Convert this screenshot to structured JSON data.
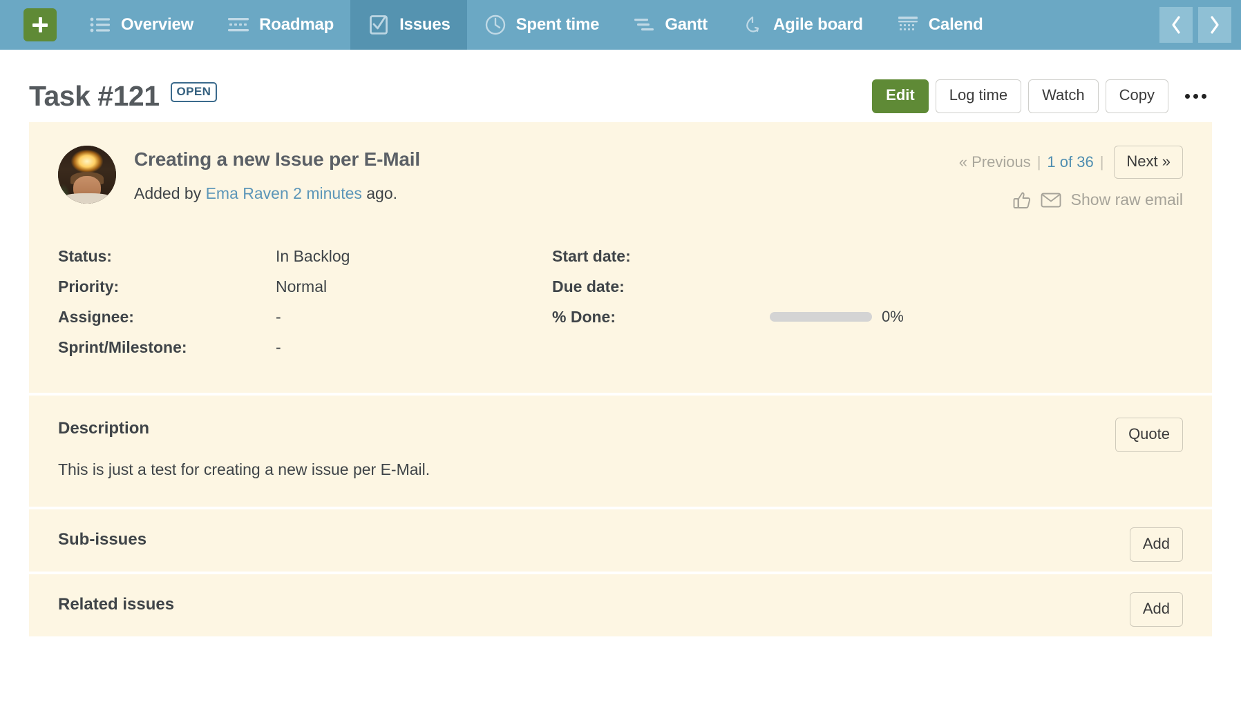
{
  "nav": {
    "add_label": "+",
    "items": [
      {
        "label": "Overview",
        "icon": "list-icon",
        "active": false
      },
      {
        "label": "Roadmap",
        "icon": "roadmap-icon",
        "active": false
      },
      {
        "label": "Issues",
        "icon": "checkbox-icon",
        "active": true
      },
      {
        "label": "Spent time",
        "icon": "clock-icon",
        "active": false
      },
      {
        "label": "Gantt",
        "icon": "gantt-icon",
        "active": false
      },
      {
        "label": "Agile board",
        "icon": "agile-icon",
        "active": false
      },
      {
        "label": "Calend",
        "icon": "calendar-icon",
        "active": false
      }
    ],
    "prev_icon": "chevron-left-icon",
    "next_icon": "chevron-right-icon"
  },
  "header": {
    "title": "Task #121",
    "status": "OPEN",
    "actions": {
      "edit": "Edit",
      "log_time": "Log time",
      "watch": "Watch",
      "copy": "Copy",
      "more": "•••"
    }
  },
  "issue": {
    "subject": "Creating a new Issue per E-Mail",
    "author_prefix": "Added by ",
    "author": "Ema Raven",
    "time_sep": " ",
    "time": "2 minutes",
    "author_suffix": " ago.",
    "pager": {
      "previous": "« Previous",
      "sep": "|",
      "count": "1 of 36",
      "next": "Next »"
    },
    "meta_actions": {
      "thumbs_up": "thumbs-up-icon",
      "envelope": "envelope-icon",
      "raw_email": "Show raw email"
    },
    "attributes": [
      {
        "label": "Status:",
        "value": "In Backlog"
      },
      {
        "label": "Start date:",
        "value": ""
      },
      {
        "label": "Priority:",
        "value": "Normal"
      },
      {
        "label": "Due date:",
        "value": ""
      },
      {
        "label": "Assignee:",
        "value": "-"
      },
      {
        "label": "% Done:",
        "value": ""
      },
      {
        "label": "Sprint/Milestone:",
        "value": "-"
      }
    ],
    "progress": {
      "percent": 0,
      "text": "0%"
    }
  },
  "sections": {
    "description": {
      "title": "Description",
      "action": "Quote",
      "body": "This is just a test for creating a new issue per E-Mail."
    },
    "sub_issues": {
      "title": "Sub-issues",
      "action": "Add"
    },
    "related_issues": {
      "title": "Related issues",
      "action": "Add"
    }
  },
  "colors": {
    "nav_bg": "#6ba8c4",
    "nav_active": "#5593b0",
    "accent_green": "#5f8a36",
    "card_bg": "#fdf6e3",
    "link_blue": "#5c96b8",
    "badge_blue": "#34607f"
  }
}
